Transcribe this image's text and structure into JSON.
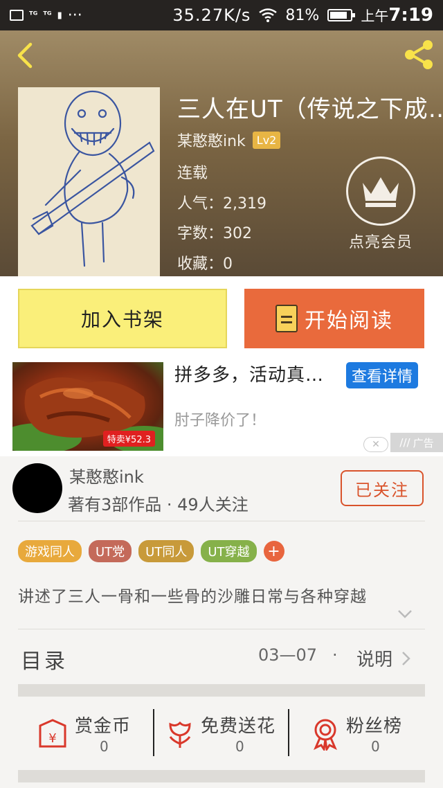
{
  "status_bar": {
    "network_speed": "35.27K/s",
    "battery": "81%",
    "time_prefix": "上午",
    "time": "7:19",
    "more": "···"
  },
  "book": {
    "title": "三人在UT（传说之下成…",
    "author": "某憨憨ink",
    "level": "Lv2",
    "status": "连载",
    "popularity": "人气：2,319",
    "word_count": "字数：302",
    "favorites": "收藏：0",
    "vip_label": "点亮会员"
  },
  "actions": {
    "add_to_shelf": "加入书架",
    "start_reading": "开始阅读"
  },
  "ad": {
    "title": "拼多多，活动真…",
    "detail_button": "查看详情",
    "subtitle": "肘子降价了！",
    "price_tag": "特卖¥52.3",
    "ad_label": "广告"
  },
  "author_card": {
    "name": "某憨憨ink",
    "stats": "著有3部作品 · 49人关注",
    "follow_button": "已关注"
  },
  "tags": [
    {
      "label": "游戏同人",
      "color": "#e8a93c"
    },
    {
      "label": "UT党",
      "color": "#c46a5a"
    },
    {
      "label": "UT同人",
      "color": "#c89a3a"
    },
    {
      "label": "UT穿越",
      "color": "#86b14a"
    }
  ],
  "description": "讲述了三人一骨和一些骨的沙雕日常与各种穿越",
  "catalog": {
    "title": "目录",
    "date": "03—07",
    "separator": "·",
    "note": "说明"
  },
  "rewards": [
    {
      "label": "赏金币",
      "count": "0",
      "icon": "coin-envelope-icon"
    },
    {
      "label": "免费送花",
      "count": "0",
      "icon": "flower-icon"
    },
    {
      "label": "粉丝榜",
      "count": "0",
      "icon": "medal-icon"
    }
  ],
  "colors": {
    "accent_orange": "#e96a3c",
    "shelf_yellow": "#faef7a",
    "ad_blue": "#1d7ae0",
    "follow_red": "#d9532b"
  }
}
